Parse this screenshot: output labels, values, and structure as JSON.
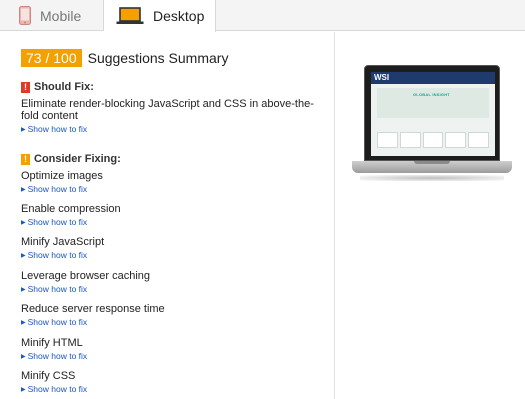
{
  "tabs": [
    {
      "label": "Mobile",
      "icon": "mobile-phone-icon",
      "active": false
    },
    {
      "label": "Desktop",
      "icon": "laptop-icon",
      "active": true
    }
  ],
  "summary": {
    "score": "73 / 100",
    "title": "Suggestions Summary",
    "score_color": "#f4a100"
  },
  "should_fix": {
    "badge": "!",
    "title": "Should Fix:",
    "badge_color": "#dd3a2c",
    "rules": [
      {
        "title": "Eliminate render-blocking JavaScript and CSS in above-the-fold content",
        "link": "Show how to fix"
      }
    ]
  },
  "consider_fixing": {
    "badge": "!",
    "title": "Consider Fixing:",
    "badge_color": "#f4a100",
    "rules": [
      {
        "title": "Optimize images",
        "link": "Show how to fix"
      },
      {
        "title": "Enable compression",
        "link": "Show how to fix"
      },
      {
        "title": "Minify JavaScript",
        "link": "Show how to fix"
      },
      {
        "title": "Leverage browser caching",
        "link": "Show how to fix"
      },
      {
        "title": "Reduce server response time",
        "link": "Show how to fix"
      },
      {
        "title": "Minify HTML",
        "link": "Show how to fix"
      },
      {
        "title": "Minify CSS",
        "link": "Show how to fix"
      }
    ]
  },
  "preview": {
    "logo_text": "WSI",
    "tagline": "GLOBAL INSIGHT"
  }
}
